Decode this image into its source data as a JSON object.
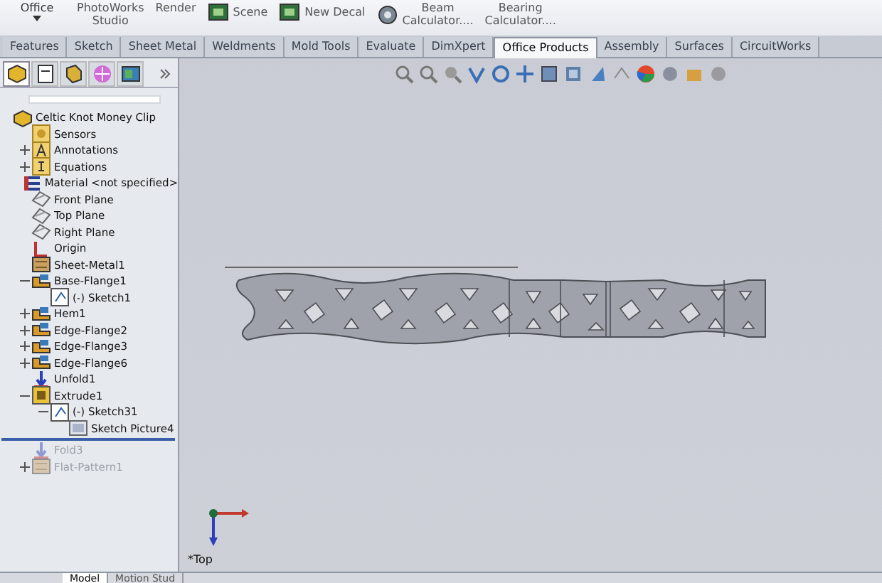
{
  "ribbon": {
    "groups": [
      {
        "label": "Office",
        "kind": "dropdown"
      },
      {
        "label": "PhotoWorks\nStudio",
        "kind": "text"
      },
      {
        "label": "Render",
        "kind": "text"
      },
      {
        "label": "Scene",
        "kind": "icons"
      },
      {
        "label": "New Decal",
        "kind": "icons"
      },
      {
        "label": "Beam\nCalculator....",
        "kind": "calc"
      },
      {
        "label": "Bearing\nCalculator....",
        "kind": "text"
      }
    ]
  },
  "tabs": [
    {
      "label": "Features",
      "selected": false
    },
    {
      "label": "Sketch",
      "selected": false
    },
    {
      "label": "Sheet Metal",
      "selected": false
    },
    {
      "label": "Weldments",
      "selected": false
    },
    {
      "label": "Mold Tools",
      "selected": false
    },
    {
      "label": "Evaluate",
      "selected": false
    },
    {
      "label": "DimXpert",
      "selected": false
    },
    {
      "label": "Office Products",
      "selected": true
    },
    {
      "label": "Assembly",
      "selected": false
    },
    {
      "label": "Surfaces",
      "selected": false
    },
    {
      "label": "CircuitWorks",
      "selected": false
    }
  ],
  "panel_tabs": [
    {
      "kind": "tree",
      "selected": true
    },
    {
      "kind": "property",
      "selected": false
    },
    {
      "kind": "config",
      "selected": false
    },
    {
      "kind": "dimxpert",
      "selected": false
    },
    {
      "kind": "display",
      "selected": false
    }
  ],
  "tree": {
    "label": "Celtic Knot Money Clip",
    "kind": "part",
    "children": [
      {
        "label": "Sensors",
        "kind": "sensors"
      },
      {
        "label": "Annotations",
        "kind": "annotations",
        "expanded": false
      },
      {
        "label": "Equations",
        "kind": "equations",
        "expanded": false
      },
      {
        "label": "Material <not specified>",
        "kind": "material"
      },
      {
        "label": "Front Plane",
        "kind": "plane"
      },
      {
        "label": "Top Plane",
        "kind": "plane"
      },
      {
        "label": "Right Plane",
        "kind": "plane"
      },
      {
        "label": "Origin",
        "kind": "origin"
      },
      {
        "label": "Sheet-Metal1",
        "kind": "sheetmetal"
      },
      {
        "label": "Base-Flange1",
        "kind": "flange",
        "expanded": true,
        "children": [
          {
            "label": "(-) Sketch1",
            "kind": "sketch"
          }
        ]
      },
      {
        "label": "Hem1",
        "kind": "flange",
        "expanded": false
      },
      {
        "label": "Edge-Flange2",
        "kind": "flange",
        "expanded": false
      },
      {
        "label": "Edge-Flange3",
        "kind": "flange",
        "expanded": false
      },
      {
        "label": "Edge-Flange6",
        "kind": "flange",
        "expanded": false
      },
      {
        "label": "Unfold1",
        "kind": "unfold"
      },
      {
        "label": "Extrude1",
        "kind": "extrude",
        "expanded": true,
        "children": [
          {
            "label": "(-) Sketch31",
            "kind": "sketch",
            "expanded": true,
            "children": [
              {
                "label": "Sketch Picture4",
                "kind": "picture"
              }
            ]
          }
        ]
      },
      {
        "label": "Fold3",
        "kind": "unfold",
        "disabled": true,
        "rollback_before": true
      },
      {
        "label": "Flat-Pattern1",
        "kind": "sheetmetal",
        "disabled": true,
        "expanded": false
      }
    ]
  },
  "view": {
    "orientation": "*Top"
  },
  "bottom_tabs": [
    {
      "label": "Model",
      "selected": true
    },
    {
      "label": "Motion Stud",
      "selected": false
    }
  ]
}
